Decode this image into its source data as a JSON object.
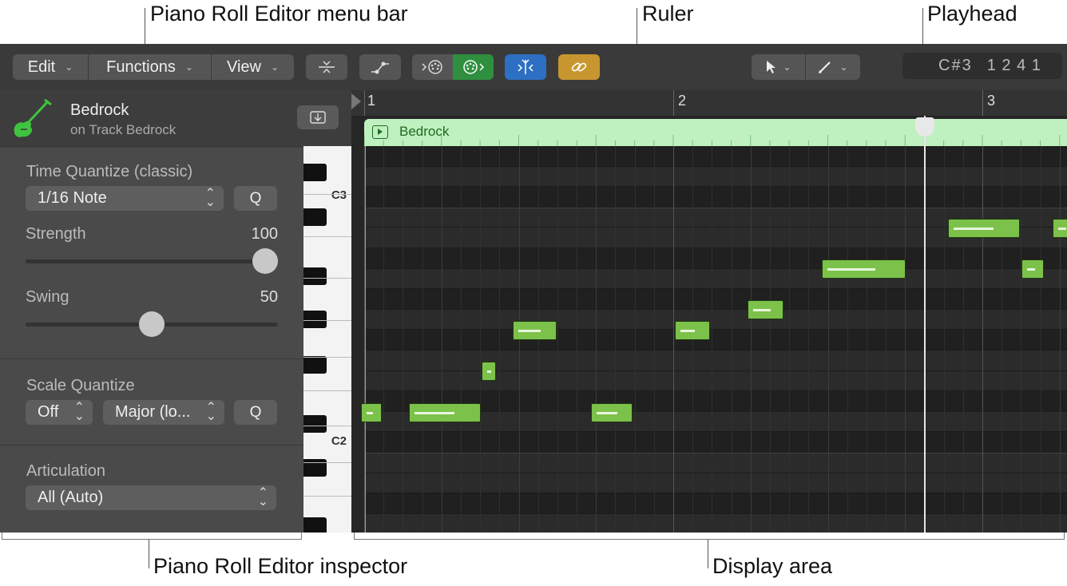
{
  "callouts": {
    "menubar": "Piano Roll Editor menu bar",
    "ruler": "Ruler",
    "playhead": "Playhead",
    "inspector": "Piano Roll Editor inspector",
    "display": "Display area"
  },
  "menubar": {
    "edit": "Edit",
    "functions": "Functions",
    "view": "View",
    "lcd_note": "C#3",
    "lcd_position": "1 2 4 1",
    "colors": {
      "midi_in": "#2f8f3f",
      "catch": "#2d6fc2",
      "link": "#c7962f"
    }
  },
  "icons": {
    "menu_chevron": "chevron-down-icon",
    "collapse": "collapse-icon",
    "automation": "automation-curve-icon",
    "midi_out": "midi-out-icon",
    "midi_in": "midi-in-icon",
    "catch": "catch-playhead-icon",
    "link": "link-icon",
    "pointer": "pointer-tool-icon",
    "pencil": "pencil-tool-icon",
    "instrument": "bass-guitar-icon",
    "download": "import-icon"
  },
  "inspector": {
    "track_name": "Bedrock",
    "track_sub": "on Track Bedrock",
    "time_quantize_label": "Time Quantize (classic)",
    "time_quantize_value": "1/16 Note",
    "q_label": "Q",
    "strength_label": "Strength",
    "strength_value": "100",
    "strength_level": 1.0,
    "swing_label": "Swing",
    "swing_value": "50",
    "swing_level": 0.5,
    "scale_quantize_label": "Scale Quantize",
    "scale_root": "Off",
    "scale_type": "Major (lo...",
    "articulation_label": "Articulation",
    "articulation_value": "All (Auto)"
  },
  "keyboard": {
    "c3": "C3",
    "c2": "C2"
  },
  "ruler": {
    "bar1": "1",
    "bar2": "2",
    "bar3": "3"
  },
  "region": {
    "name": "Bedrock"
  }
}
